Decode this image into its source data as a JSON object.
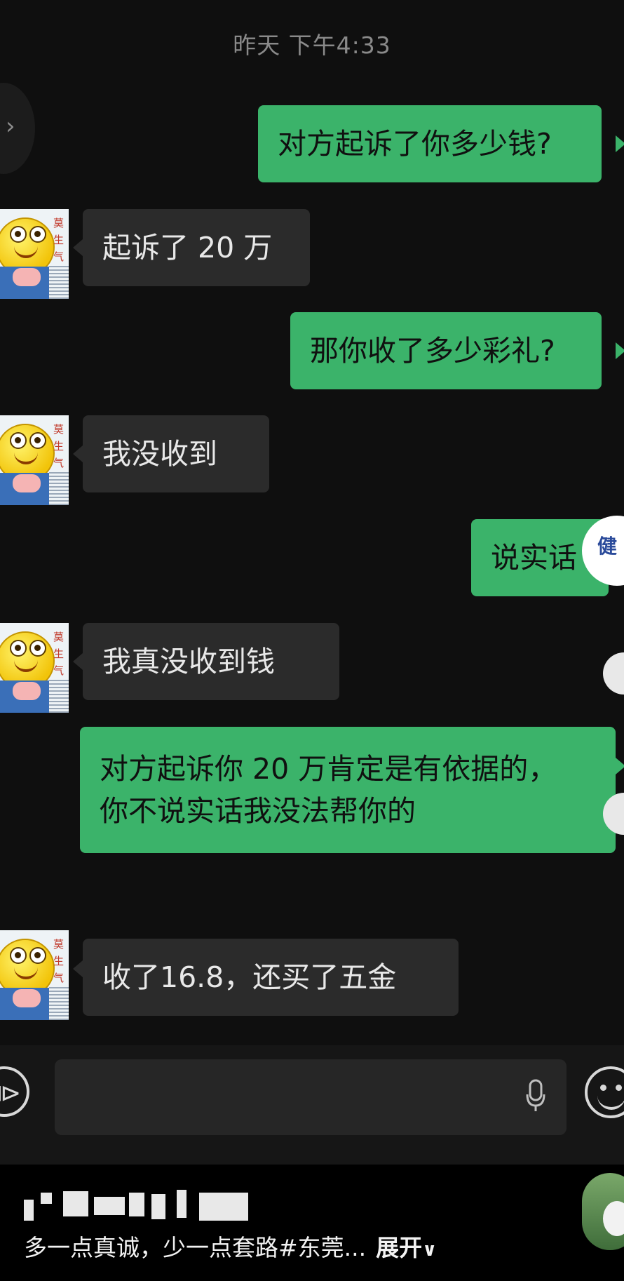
{
  "chat": {
    "timestamp": "昨天 下午4:33",
    "messages": [
      {
        "side": "sent",
        "text": "对方起诉了你多少钱?"
      },
      {
        "side": "recv",
        "text": "起诉了 20 万"
      },
      {
        "side": "sent",
        "text": "那你收了多少彩礼?"
      },
      {
        "side": "recv",
        "text": "我没收到"
      },
      {
        "side": "sent",
        "text": "说实话"
      },
      {
        "side": "recv",
        "text": "我真没收到钱"
      },
      {
        "side": "sent",
        "text": "对方起诉你 20 万肯定是有依据的，\n你不说实话我没法帮你的"
      },
      {
        "side": "recv",
        "text": "收了16.8，还买了五金"
      }
    ],
    "avatar_text": "莫生气"
  },
  "input_bar": {
    "voice_icon": "voice-icon",
    "mic_icon": "microphone-icon",
    "emoji_icon": "emoji-icon"
  },
  "footer": {
    "caption": "多一点真诚，少一点套路#东莞...",
    "expand_label": "展开"
  },
  "colors": {
    "background": "#0f0f0f",
    "sent_bubble": "#3bb36a",
    "recv_bubble": "#2b2b2b",
    "timestamp": "#8a8a8a"
  }
}
